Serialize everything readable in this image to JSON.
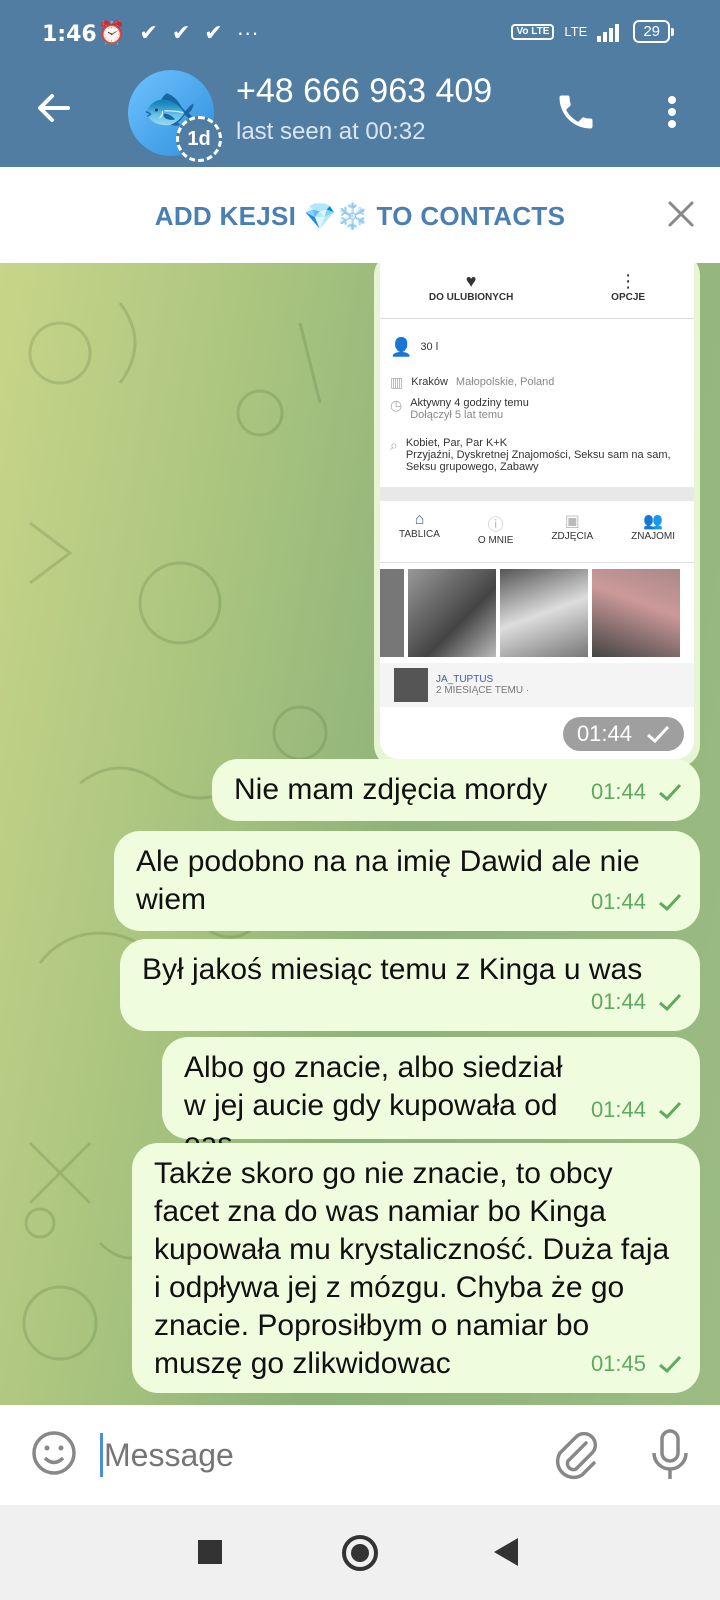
{
  "status_bar": {
    "time": "1:46",
    "left_icons": [
      "⏰",
      "✔",
      "✔",
      "✔",
      "···"
    ],
    "volte": "Vo LTE",
    "signal": "LTE",
    "battery": "29"
  },
  "header": {
    "contact_name": "+48 666 963 409",
    "last_seen": "last seen at 00:32",
    "story_badge": "1d"
  },
  "add_contact_banner": {
    "label": "ADD KEJSI 💎❄️ TO CONTACTS"
  },
  "image_message": {
    "time": "01:44",
    "screenshot": {
      "actions": [
        "DO ULUBIONYCH",
        "OPCJE"
      ],
      "age": "30 l",
      "city": "Kraków",
      "region": "Małopolskie, Poland",
      "active": "Aktywny 4 godziny temu",
      "joined": "Dołączył 5 lat temu",
      "seeking": "Kobiet, Par, Par K+K",
      "interests": "Przyjaźni, Dyskretnej Znajomości, Seksu sam na sam, Seksu grupowego, Zabawy",
      "tabs": [
        "TABLICA",
        "O MNIE",
        "ZDJĘCIA",
        "ZNAJOMI"
      ],
      "post_user": "JA_TUPTUS",
      "post_time": "2 MIESIĄCE TEMU ·"
    }
  },
  "messages": [
    {
      "text": "Nie mam zdjęcia mordy",
      "time": "01:44"
    },
    {
      "text": "Ale podobno na na imię Dawid ale nie wiem",
      "time": "01:44"
    },
    {
      "text": "Był jakoś miesiąc temu z Kinga u was",
      "time": "01:44"
    },
    {
      "text": "Albo go znacie, albo siedział w jej aucie gdy kupowała od eas",
      "time": "01:44"
    },
    {
      "text": "Także skoro go nie znacie, to obcy facet zna do was namiar bo Kinga kupowała mu krystaliczność. Duża faja i odpływa jej z mózgu. Chyba że go znacie. Poprosiłbym o namiar bo muszę go zlikwidowac",
      "time": "01:45"
    }
  ],
  "composer": {
    "placeholder": "Message"
  },
  "colors": {
    "header": "#517da2",
    "bubble_out": "#effdde",
    "time_green": "#5fa960",
    "banner_text": "#4a7fb3"
  }
}
